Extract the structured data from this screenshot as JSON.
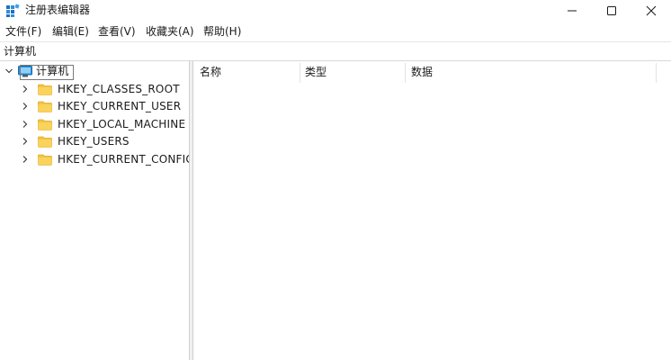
{
  "window": {
    "title": "注册表编辑器"
  },
  "menu": {
    "items": [
      {
        "label": "文件(F)"
      },
      {
        "label": "编辑(E)"
      },
      {
        "label": "查看(V)"
      },
      {
        "label": "收藏夹(A)"
      },
      {
        "label": "帮助(H)"
      }
    ]
  },
  "address": {
    "path": "计算机"
  },
  "tree": {
    "root": {
      "label": "计算机",
      "expanded": true
    },
    "children": [
      {
        "label": "HKEY_CLASSES_ROOT"
      },
      {
        "label": "HKEY_CURRENT_USER"
      },
      {
        "label": "HKEY_LOCAL_MACHINE"
      },
      {
        "label": "HKEY_USERS"
      },
      {
        "label": "HKEY_CURRENT_CONFIG"
      }
    ]
  },
  "list": {
    "columns": [
      {
        "label": "名称"
      },
      {
        "label": "类型"
      },
      {
        "label": "数据"
      }
    ]
  },
  "colors": {
    "folder": "#f5c342",
    "folder_dark": "#e0a92a",
    "monitor": "#2e8fd6"
  }
}
